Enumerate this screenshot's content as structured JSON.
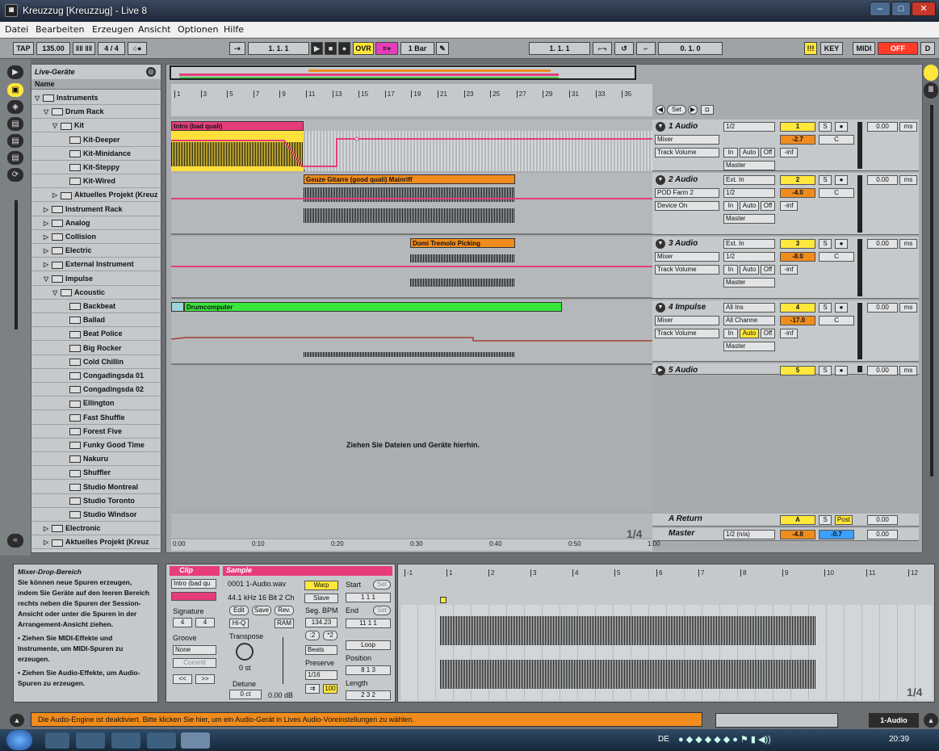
{
  "window": {
    "title": "Kreuzzug  [Kreuzzug] - Live 8",
    "min": "–",
    "max": "□",
    "close": "✕"
  },
  "menu": [
    "Datei",
    "Bearbeiten",
    "Erzeugen",
    "Ansicht",
    "Optionen",
    "Hilfe"
  ],
  "transport": {
    "tap": "TAP",
    "tempo": "135.00",
    "sig": "4 / 4",
    "pos": "1. 1. 1",
    "ovr": "OVR",
    "quant": "1 Bar",
    "loop_start": "1. 1. 1",
    "loop_len": "0. 1. 0",
    "key": "KEY",
    "midi": "MIDI",
    "off": "OFF",
    "d": "D"
  },
  "browser": {
    "title": "Live-Geräte",
    "name_col": "Name",
    "items": [
      "Instruments",
      "Drum Rack",
      "Kit",
      "Kit-Deeper",
      "Kit-Minidance",
      "Kit-Steppy",
      "Kit-Wired",
      "Aktuelles Projekt (Kreuz",
      "Instrument Rack",
      "Analog",
      "Collision",
      "Electric",
      "External Instrument",
      "Impulse",
      "Acoustic",
      "Backbeat",
      "Ballad",
      "Beat Police",
      "Big Rocker",
      "Cold Chillin",
      "Congadingsda 01",
      "Congadingsda 02",
      "Ellington",
      "Fast Shuffle",
      "Forest Five",
      "Funky Good Time",
      "Nakuru",
      "Shuffler",
      "Studio Montreal",
      "Studio Toronto",
      "Studio Windsor",
      "Electronic",
      "Aktuelles Projekt (Kreuz"
    ]
  },
  "ruler": {
    "bars": [
      "1",
      "3",
      "5",
      "7",
      "9",
      "11",
      "13",
      "15",
      "17",
      "19",
      "21",
      "23",
      "25",
      "27",
      "29",
      "31",
      "33",
      "35"
    ],
    "times": [
      "0:00",
      "0:10",
      "0:20",
      "0:30",
      "0:40",
      "0:50",
      "1:00"
    ],
    "set": "Set",
    "zoom": "1/4"
  },
  "clips": {
    "c1": "Intro (bad quali)",
    "c2": "Geuze Gitarre (good quali) Mainriff",
    "c3": "Domi Tremolo Picking",
    "c4": "Drumcomputer"
  },
  "drop_hint": "Ziehen Sie Dateien und Geräte hierhin.",
  "tracks": [
    {
      "name": "1 Audio",
      "in": "1/2",
      "dev": "Mixer",
      "param": "Track Volume",
      "num": "1",
      "vol": "-2.7",
      "pan": "C",
      "route": "Master",
      "inf": "-inf",
      "delay": "0.00",
      "ms": "ms",
      "s": "S",
      "in_b": "In",
      "auto": "Auto",
      "offb": "Off"
    },
    {
      "name": "2 Audio",
      "in": "Ext. In",
      "ch": "1/2",
      "dev": "POD Farm 2",
      "param": "Device On",
      "num": "2",
      "vol": "-4.0",
      "pan": "C",
      "route": "Master",
      "inf": "-inf",
      "delay": "0.00",
      "ms": "ms"
    },
    {
      "name": "3 Audio",
      "in": "Ext. In",
      "ch": "1/2",
      "dev": "Mixer",
      "param": "Track Volume",
      "num": "3",
      "vol": "-8.0",
      "pan": "C",
      "route": "Master",
      "inf": "-inf",
      "delay": "0.00",
      "ms": "ms"
    },
    {
      "name": "4 Impulse",
      "in": "All Ins",
      "ch": "All Channe",
      "dev": "Mixer",
      "param": "Track Volume",
      "num": "4",
      "vol": "-17.0",
      "pan": "C",
      "route": "Master",
      "inf": "-inf",
      "delay": "0.00",
      "ms": "ms"
    },
    {
      "name": "5 Audio",
      "num": "5",
      "delay": "0.00",
      "ms": "ms"
    }
  ],
  "returns": {
    "a_name": "A Return",
    "a_num": "A",
    "post": "Post",
    "a_delay": "0.00",
    "m_name": "Master",
    "m_route": "1/2 (n/a)",
    "m_vol": "-4.8",
    "m_pan": "-0.7",
    "m_delay": "0.00",
    "ms": "ms"
  },
  "drop_area": {
    "title": "Mixer-Drop-Bereich",
    "text": "Sie können neue Spuren erzeugen, indem Sie Geräte auf den leeren Bereich rechts neben die Spuren der Session-Ansicht oder unter die Spuren in der Arrangement-Ansicht ziehen.",
    "b1": "Ziehen Sie MIDI-Effekte und Instrumente, um MIDI-Spuren zu erzeugen.",
    "b2": "Ziehen Sie Audio-Effekte, um Audio-Spuren zu erzeugen."
  },
  "clip_view": {
    "clip_t": "Clip",
    "sample_t": "Sample",
    "clip_name": "Intro (bad qu",
    "file": "0001 1-Audio.wav",
    "fmt": "44.1 kHz 16 Bit 2 Ch",
    "sig": "Signature",
    "sig_n": "4",
    "sig_d": "4",
    "groove": "Groove",
    "groove_v": "None",
    "commit": "Commit",
    "edit": "Edit",
    "save": "Save",
    "rev": "Rev.",
    "hiq": "Hi-Q",
    "ram": "RAM",
    "transpose": "Transpose",
    "st": "0 st",
    "detune": "Detune",
    "ct": "0 ct",
    "db": "0.00 dB",
    "warp": "Warp",
    "slave": "Slave",
    "segbpm": "Seg. BPM",
    "bpm": "134.23",
    "beats": "Beats",
    "preserve": "Preserve",
    "pres_v": "1/16",
    "pct": "100",
    "start": "Start",
    "end": "End",
    "loop": "Loop",
    "position": "Position",
    "length": "Length",
    "setl": "Set"
  },
  "editor": {
    "bars": [
      "-1",
      "1",
      "2",
      "3",
      "4",
      "5",
      "6",
      "7",
      "8",
      "9",
      "10",
      "11",
      "12"
    ],
    "zoom": "1/4"
  },
  "status": "Die Audio-Engine ist deaktiviert. Bitte klicken Sie hier, um ein Audio-Gerät in Lives Audio-Voreinstellungen zu wählen.",
  "track_sel": "1-Audio",
  "taskbar": {
    "lang": "DE",
    "time": "20:39"
  }
}
